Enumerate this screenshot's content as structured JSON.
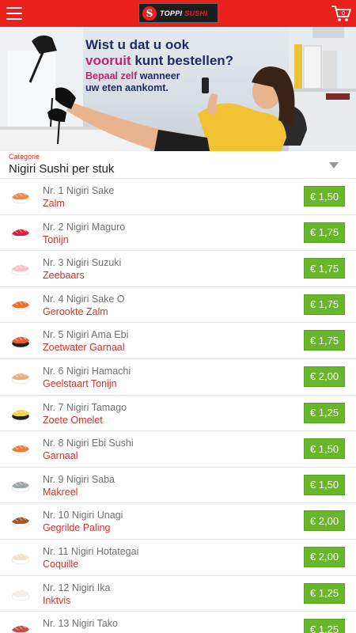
{
  "header": {
    "logo_text_1": "TOPPI",
    "logo_text_2": "SUSHI",
    "menu_icon": "hamburger-menu-icon",
    "cart_icon": "shopping-cart-icon",
    "cart_count": "0",
    "brand_color": "#e8211c"
  },
  "banner": {
    "line1": "Wist u dat u ook",
    "line2_a": "vooruit",
    "line2_b": "kunt",
    "line2_c": "bestellen?",
    "line3_a": "Bepaal zelf",
    "line3_b": "wanneer",
    "line4": "uw eten aankomt."
  },
  "category": {
    "label": "Categorie",
    "value": "Nigiri Sushi per stuk"
  },
  "items": [
    {
      "name": "Nr. 1 Nigiri Sake",
      "sub": "Zalm",
      "price": "€ 1,50",
      "icon": "salmon-nigiri-icon"
    },
    {
      "name": "Nr. 2 Nigiri Maguro",
      "sub": "Tonijn",
      "price": "€ 1,75",
      "icon": "tuna-nigiri-icon"
    },
    {
      "name": "Nr. 3 Nigiri Suzuki",
      "sub": "Zeebaars",
      "price": "€ 1,75",
      "icon": "seabass-nigiri-icon"
    },
    {
      "name": "Nr. 4 Nigiri Sake O",
      "sub": "Gerookte Zalm",
      "price": "€ 1,75",
      "icon": "smoked-salmon-nigiri-icon"
    },
    {
      "name": "Nr. 5 Nigiri Ama Ebi",
      "sub": "Zoetwater Garnaal",
      "price": "€ 1,75",
      "icon": "shrimp-nigiri-icon"
    },
    {
      "name": "Nr. 6 Nigiri Hamachi",
      "sub": "Geelstaart Tonijn",
      "price": "€ 2,00",
      "icon": "yellowtail-nigiri-icon"
    },
    {
      "name": "Nr. 7 Nigiri Tamago",
      "sub": "Zoete Omelet",
      "price": "€ 1,25",
      "icon": "omelet-nigiri-icon"
    },
    {
      "name": "Nr. 8 Nigiri Ebi Sushi",
      "sub": "Garnaal",
      "price": "€ 1,50",
      "icon": "ebi-nigiri-icon"
    },
    {
      "name": "Nr. 9 Nigiri Saba",
      "sub": "Makreel",
      "price": "€ 1,50",
      "icon": "mackerel-nigiri-icon"
    },
    {
      "name": "Nr. 10 Nigiri Unagi",
      "sub": "Gegrilde Paling",
      "price": "€ 2,00",
      "icon": "eel-nigiri-icon"
    },
    {
      "name": "Nr. 11 Nigiri Hotategai",
      "sub": "Coquille",
      "price": "€ 2,00",
      "icon": "scallop-nigiri-icon"
    },
    {
      "name": "Nr. 12 Nigiri Ika",
      "sub": "Inktvis",
      "price": "€ 1,25",
      "icon": "squid-nigiri-icon"
    },
    {
      "name": "Nr. 13 Nigiri Tako",
      "sub": "",
      "price": "€ 1,25",
      "icon": "octopus-nigiri-icon"
    }
  ],
  "colors": {
    "price_bg": "#68b72a",
    "sub_text": "#c8352f",
    "header_bg": "#e8211c"
  }
}
